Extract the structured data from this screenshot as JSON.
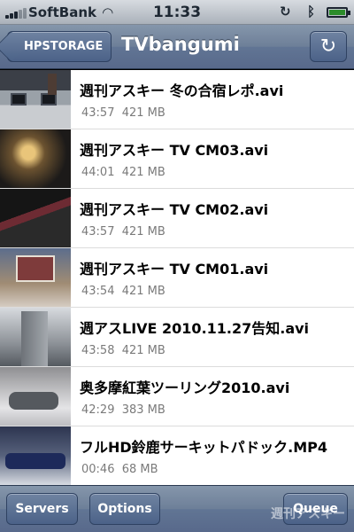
{
  "status_bar": {
    "carrier": "SoftBank",
    "wifi_icon": "wifi-icon",
    "time": "11:33",
    "lock_icon": "rotation-lock-icon",
    "bluetooth_icon": "bluetooth-icon",
    "battery_icon": "battery-icon"
  },
  "nav": {
    "back_label": "HPSTORAGE",
    "title": "TVbangumi",
    "refresh_icon": "refresh-icon"
  },
  "files": [
    {
      "name": "週刊アスキー 冬の合宿レポ.avi",
      "duration": "43:57",
      "size": "421 MB"
    },
    {
      "name": "週刊アスキー TV CM03.avi",
      "duration": "44:01",
      "size": "421 MB"
    },
    {
      "name": "週刊アスキー TV CM02.avi",
      "duration": "43:57",
      "size": "421 MB"
    },
    {
      "name": "週刊アスキー TV CM01.avi",
      "duration": "43:54",
      "size": "421 MB"
    },
    {
      "name": "週アスLIVE 2010.11.27告知.avi",
      "duration": "43:58",
      "size": "421 MB"
    },
    {
      "name": "奥多摩紅葉ツーリング2010.avi",
      "duration": "42:29",
      "size": "383 MB"
    },
    {
      "name": "フルHD鈴鹿サーキットパドック.MP4",
      "duration": "00:46",
      "size": "68 MB"
    }
  ],
  "toolbar": {
    "servers_label": "Servers",
    "options_label": "Options",
    "queue_label": "Queue"
  },
  "watermark": "週刊アスキー"
}
